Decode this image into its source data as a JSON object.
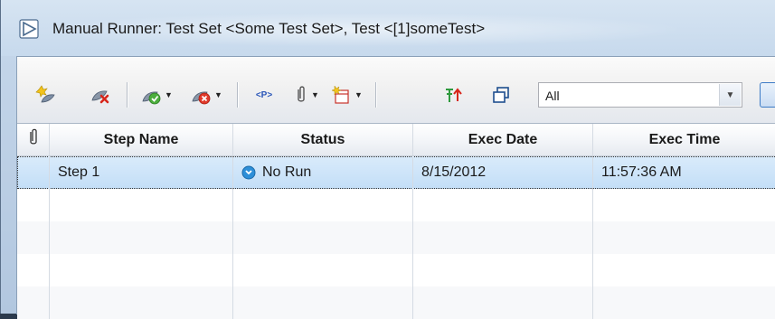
{
  "window": {
    "title": "Manual Runner: Test Set <Some Test Set>, Test <[1]someTest>",
    "icon": "runner-arrow-icon"
  },
  "toolbar": {
    "buttons": [
      {
        "name": "new-step-icon"
      },
      {
        "name": "delete-step-icon"
      },
      {
        "name": "pass-selected-icon",
        "dropdown": true
      },
      {
        "name": "fail-selected-icon",
        "dropdown": true
      },
      {
        "name": "insert-parameter-icon",
        "label": "<P>"
      },
      {
        "name": "attachment-icon",
        "dropdown": true
      },
      {
        "name": "new-defect-icon",
        "dropdown": true
      },
      {
        "name": "pin-icon"
      },
      {
        "name": "restore-window-icon"
      }
    ],
    "filter": {
      "value": "All"
    }
  },
  "grid": {
    "columns": [
      {
        "key": "attachment",
        "label": ""
      },
      {
        "key": "step_name",
        "label": "Step Name"
      },
      {
        "key": "status",
        "label": "Status"
      },
      {
        "key": "exec_date",
        "label": "Exec Date"
      },
      {
        "key": "exec_time",
        "label": "Exec Time"
      }
    ],
    "rows": [
      {
        "step_name": "Step 1",
        "status": "No Run",
        "exec_date": "8/15/2012",
        "exec_time": "11:57:36 AM",
        "status_icon": "no-run-icon"
      }
    ]
  },
  "colors": {
    "status_no_run": "#2e8fd8",
    "selection": "#c3def7",
    "pass": "#3a9e3a",
    "fail": "#d23a2a"
  }
}
